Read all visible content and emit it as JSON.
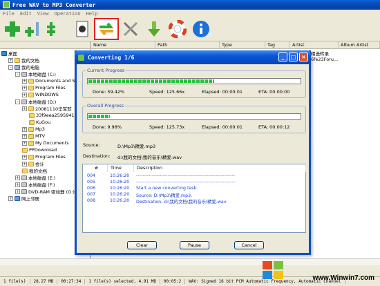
{
  "app": {
    "title": "Free WAV to MP3 Converter",
    "menu": [
      "File",
      "Edit",
      "View",
      "Operation",
      "Help"
    ]
  },
  "toolbar": {
    "buttons": [
      {
        "name": "add-icon"
      },
      {
        "name": "add-multiple-icon"
      },
      {
        "name": "remove-icon"
      },
      {
        "name": "move-icon"
      },
      {
        "name": "play-icon"
      },
      {
        "name": "convert-icon"
      },
      {
        "name": "settings-icon"
      },
      {
        "name": "download-icon"
      },
      {
        "name": "help-lifebuoy-icon"
      },
      {
        "name": "info-icon"
      }
    ]
  },
  "tree": {
    "items": [
      {
        "label": "桌面",
        "icon": "desktop",
        "exp": ""
      },
      {
        "label": "我的文档",
        "icon": "folder",
        "exp": "+"
      },
      {
        "label": "我的电脑",
        "icon": "pc",
        "exp": "-"
      },
      {
        "label": "本地磁盘 (C:)",
        "icon": "drive",
        "exp": "-"
      },
      {
        "label": "Documents and S",
        "icon": "folder",
        "exp": "+"
      },
      {
        "label": "Program Files",
        "icon": "folder",
        "exp": "+"
      },
      {
        "label": "WINDOWS",
        "icon": "folder",
        "exp": "+"
      },
      {
        "label": "本地磁盘 (D:)",
        "icon": "drive",
        "exp": "-"
      },
      {
        "label": "20081110华军软",
        "icon": "folder",
        "exp": "+"
      },
      {
        "label": "33f9eea2595941",
        "icon": "folder",
        "exp": ""
      },
      {
        "label": "KuGou",
        "icon": "folder",
        "exp": ""
      },
      {
        "label": "Mp3",
        "icon": "folder",
        "exp": "+"
      },
      {
        "label": "MTV",
        "icon": "folder",
        "exp": "+"
      },
      {
        "label": "My Documents",
        "icon": "folder",
        "exp": "+"
      },
      {
        "label": "PPDownload",
        "icon": "folder",
        "exp": ""
      },
      {
        "label": "Program Files",
        "icon": "folder",
        "exp": "+"
      },
      {
        "label": "会计",
        "icon": "folder",
        "exp": "+"
      },
      {
        "label": "我的文档",
        "icon": "folder",
        "exp": ""
      },
      {
        "label": "本地磁盘 (E:)",
        "icon": "drive",
        "exp": "+"
      },
      {
        "label": "本地磁盘 (F:)",
        "icon": "drive",
        "exp": "+"
      },
      {
        "label": "DVD-RAM 驱动器 (G:)",
        "icon": "drive",
        "exp": "+"
      },
      {
        "label": "网上邻居",
        "icon": "net",
        "exp": "+"
      }
    ]
  },
  "list": {
    "columns": [
      "Name",
      "Path",
      "Type",
      "Tag",
      "Artist",
      "Album Artist"
    ],
    "visible_tail": [
      "精选转录",
      "6fe23Foru..."
    ]
  },
  "dialog": {
    "title": "Converting 1/6",
    "current": {
      "label": "Current Progress",
      "progress": 59.42,
      "done": "Done:   59.42%",
      "speed": "Speed:   125.66x",
      "elapsed": "Elapsed:   00:00:01",
      "eta": "ETA:   00:00:00"
    },
    "overall": {
      "label": "Overall Progress",
      "progress": 9.98,
      "done": "Done:   9.98%",
      "speed": "Speed:   125.73x",
      "elapsed": "Elapsed:   00:00:01",
      "eta": "ETA:   00:00:12"
    },
    "source_label": "Source:",
    "source_value": "D:\\Mp3\\精爱.mp3",
    "dest_label": "Destination:",
    "dest_value": "d:\\我的文档\\我的音乐\\精爱.wav",
    "log": {
      "headers": [
        "#",
        "Time",
        "Description"
      ],
      "rows": [
        {
          "n": "004",
          "time": "10:26:20",
          "desc": "---------------------------------------------------------------"
        },
        {
          "n": "005",
          "time": "10:26:20",
          "desc": "---------------------------------------------------------------"
        },
        {
          "n": "006",
          "time": "10:26:20",
          "desc": "Start a new converting task."
        },
        {
          "n": "007",
          "time": "10:26:20",
          "desc": "Source:  D:\\Mp3\\精爱.mp3."
        },
        {
          "n": "008",
          "time": "10:26:20",
          "desc": "Destination: d:\\我的文档\\我的音乐\\精爱.wav."
        }
      ]
    },
    "buttons": {
      "clear": "Clear",
      "pause": "Pause",
      "cancel": "Cancel"
    }
  },
  "statusbar": {
    "files": "1 file(s)",
    "size": "28.27 MB",
    "duration": "00:27:34",
    "selected": "1 file(s) selected, 4.91 MB",
    "sel_duration": "00:05:2",
    "format": "WAV:  Signed 16 bit PCM Automatic Frequency, Automatic Channel"
  },
  "watermark": {
    "text": "www.Winwin7.com"
  }
}
